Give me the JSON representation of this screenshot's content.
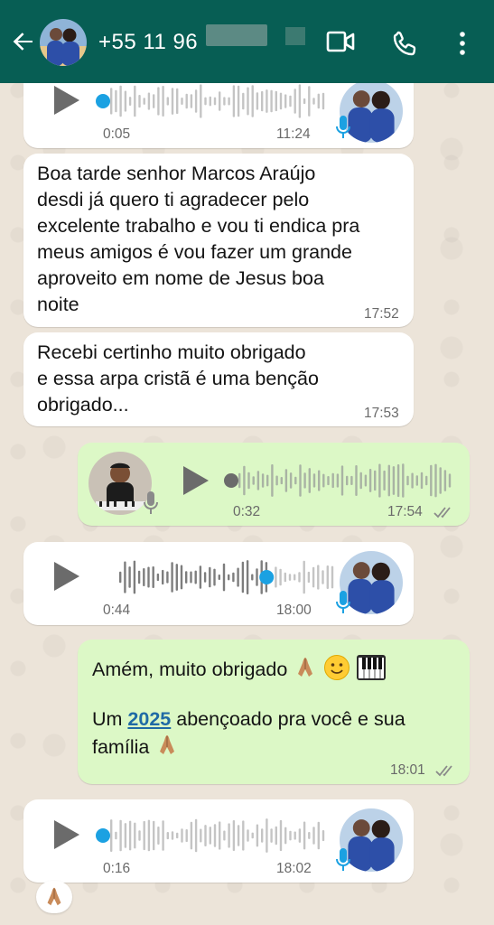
{
  "header": {
    "contact": "+55 11 96",
    "icons": [
      "back-arrow-icon",
      "video-call-icon",
      "phone-call-icon",
      "more-options-icon"
    ]
  },
  "messages": [
    {
      "type": "audio",
      "direction": "in",
      "duration": "0:05",
      "time": "11:24",
      "progress": 0.0
    },
    {
      "type": "text",
      "direction": "in",
      "text": "Boa tarde senhor Marcos Araújo desdi já quero ti agradecer pelo excelente trabalho e vou ti endica pra meus amigos é  vou fazer um grande aproveito em nome de Jesus boa noite",
      "time": "17:52"
    },
    {
      "type": "text",
      "direction": "in",
      "text": "Recebi certinho  muito obrigado e essa arpa cristã é uma benção obrigado...",
      "time": "17:53"
    },
    {
      "type": "audio",
      "direction": "out",
      "duration": "0:32",
      "time": "17:54",
      "progress": 0.0
    },
    {
      "type": "audio",
      "direction": "in",
      "duration": "0:44",
      "time": "18:00",
      "progress": 0.68
    },
    {
      "type": "text",
      "direction": "out",
      "line1": "Amém, muito obrigado ",
      "line2_pre": "Um ",
      "line2_year": "2025",
      "line2_post": " abençoado pra você e sua",
      "line3": "família ",
      "time": "18:01"
    },
    {
      "type": "audio",
      "direction": "in",
      "duration": "0:16",
      "time": "18:02",
      "progress": 0.0
    }
  ],
  "text_lines": {
    "m1": [
      "Boa tarde senhor Marcos Araújo",
      "desdi já quero ti agradecer pelo",
      "excelente trabalho e vou ti endica pra",
      "meus amigos é  vou fazer um grande",
      "aproveito em nome de Jesus boa",
      "noite"
    ],
    "m2": [
      "Recebi certinho  muito obrigado",
      "e essa arpa cristã é uma benção",
      "obrigado..."
    ]
  },
  "reaction": "praying-hands",
  "colors": {
    "header": "#075e54",
    "incoming": "#ffffff",
    "outgoing": "#dcf8c6",
    "accent_blue": "#1ba1e2",
    "link": "#1f6aa5"
  }
}
